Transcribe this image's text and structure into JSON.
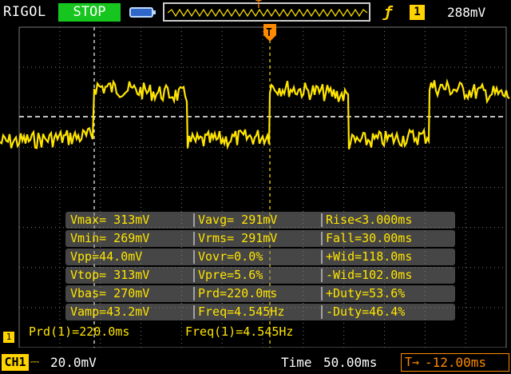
{
  "header": {
    "brand": "RIGOL",
    "run_status": "STOP",
    "trigger_marker": "T",
    "trigger_edge_symbol": "ƒ",
    "trigger_source": "1",
    "trigger_level": "288mV"
  },
  "waveform": {
    "trigger_marker": "T",
    "trigger_color": "#ff8a00",
    "trace_color": "#ffe500"
  },
  "measurements": {
    "rows": [
      [
        "Vmax= 313mV",
        "Vavg= 291mV",
        "Rise<3.000ms"
      ],
      [
        "Vmin= 269mV",
        "Vrms= 291mV",
        "Fall=30.00ms"
      ],
      [
        "Vpp=44.0mV",
        "Vovr=0.0%",
        "+Wid=118.0ms"
      ],
      [
        "Vtop= 313mV",
        "Vpre=5.6%",
        "-Wid=102.0ms"
      ],
      [
        "Vbas= 270mV",
        "Prd=220.0ms",
        "+Duty=53.6%"
      ],
      [
        "Vamp=43.2mV",
        "Freq=4.545Hz",
        "-Duty=46.4%"
      ]
    ]
  },
  "bottom_measure": {
    "prd": "Prd(1)=220.0ms",
    "freq": "Freq(1)=4.545Hz"
  },
  "status": {
    "channel": "CH1",
    "coupling_icon": "dc-coupling-icon",
    "channel_scale": "20.0mV",
    "timebase_label": "Time",
    "timebase": "50.00ms",
    "trigger_offset_icon": "T→",
    "trigger_offset": "-12.00ms"
  }
}
